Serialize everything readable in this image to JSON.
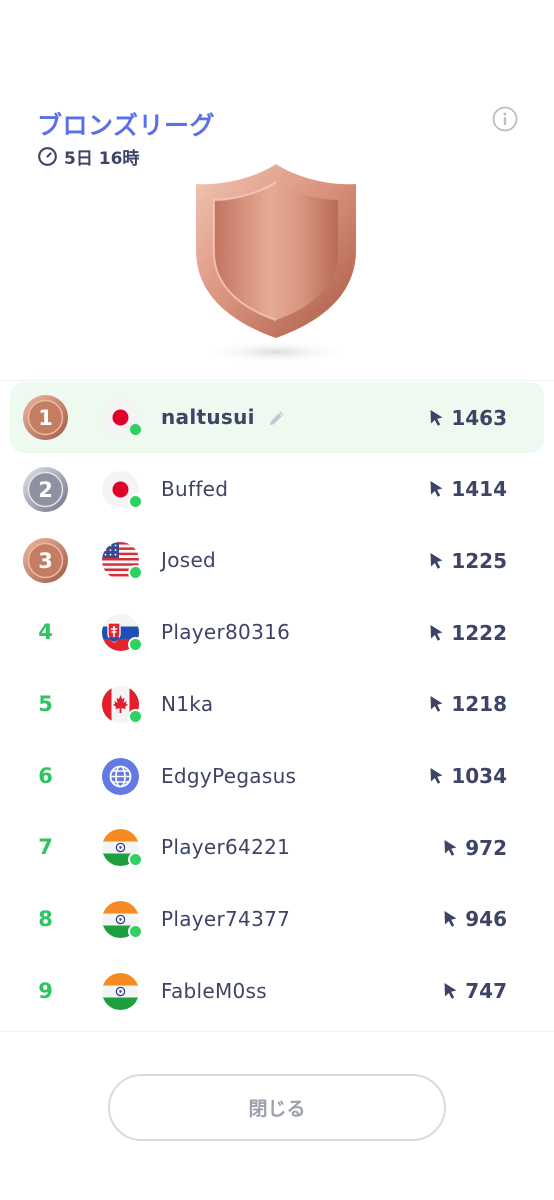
{
  "league": {
    "title": "ブロンズリーグ",
    "time_remaining": "5日 16時"
  },
  "colors": {
    "title": "#5b6fe8",
    "rank_number": "#2fc462",
    "online": "#2ed162",
    "highlight_row": "#eefaf0",
    "bronze": "#c9856b",
    "silver": "#a3a6b4",
    "text": "#3d4466"
  },
  "icons": {
    "timer": "clock-icon",
    "info": "info-icon",
    "score": "cursor-icon",
    "edit": "pencil-icon",
    "badge": "bronze-shield-icon"
  },
  "leaderboard": [
    {
      "rank": "1",
      "medal": "bronze",
      "flag": "japan",
      "online": true,
      "name": "naltusui",
      "score": "1463",
      "is_me": true
    },
    {
      "rank": "2",
      "medal": "silver",
      "flag": "japan",
      "online": true,
      "name": "Buffed",
      "score": "1414",
      "is_me": false
    },
    {
      "rank": "3",
      "medal": "bronze",
      "flag": "usa",
      "online": true,
      "name": "Josed",
      "score": "1225",
      "is_me": false
    },
    {
      "rank": "4",
      "medal": null,
      "flag": "slovakia",
      "online": true,
      "name": "Player80316",
      "score": "1222",
      "is_me": false
    },
    {
      "rank": "5",
      "medal": null,
      "flag": "canada",
      "online": true,
      "name": "N1ka",
      "score": "1218",
      "is_me": false
    },
    {
      "rank": "6",
      "medal": null,
      "flag": "globe",
      "online": false,
      "name": "EdgyPegasus",
      "score": "1034",
      "is_me": false
    },
    {
      "rank": "7",
      "medal": null,
      "flag": "india",
      "online": true,
      "name": "Player64221",
      "score": "972",
      "is_me": false
    },
    {
      "rank": "8",
      "medal": null,
      "flag": "india",
      "online": true,
      "name": "Player74377",
      "score": "946",
      "is_me": false
    },
    {
      "rank": "9",
      "medal": null,
      "flag": "india",
      "online": false,
      "name": "FableM0ss",
      "score": "747",
      "is_me": false
    }
  ],
  "close_button": {
    "label": "閉じる"
  }
}
